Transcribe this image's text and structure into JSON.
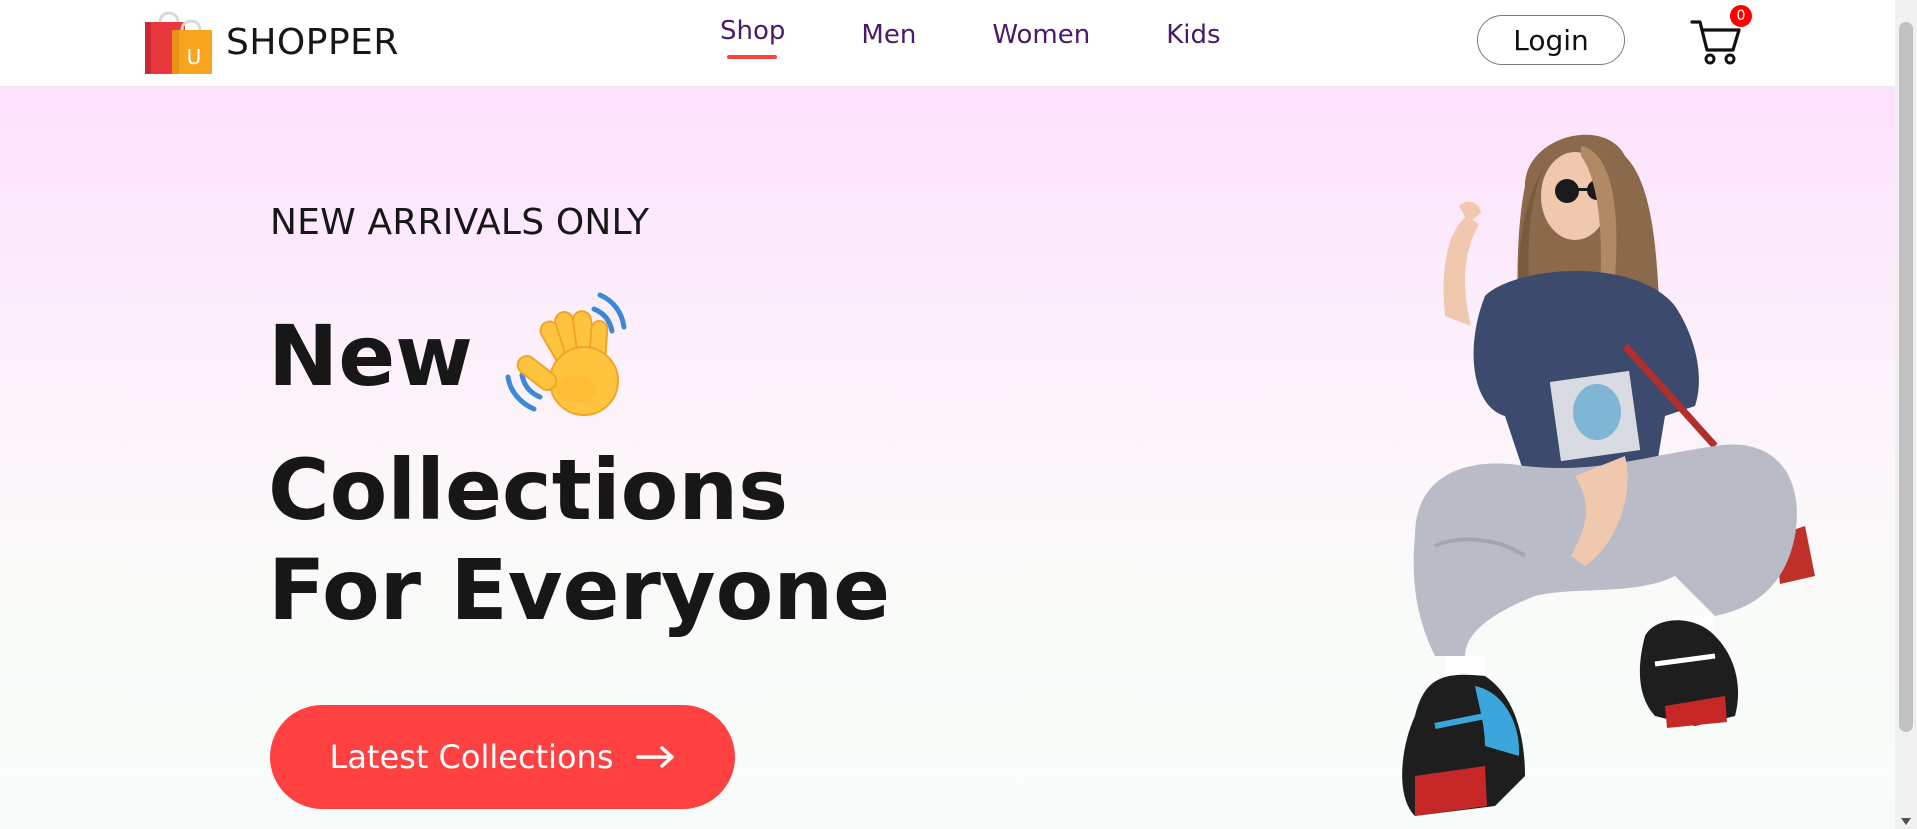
{
  "brand": {
    "name": "SHOPPER",
    "logo_letter": "U",
    "logo_icon": "shopping-bag-icon"
  },
  "nav": {
    "items": [
      {
        "label": "Shop",
        "active": true
      },
      {
        "label": "Men",
        "active": false
      },
      {
        "label": "Women",
        "active": false
      },
      {
        "label": "Kids",
        "active": false
      }
    ]
  },
  "header": {
    "login_label": "Login",
    "cart_icon": "cart-icon",
    "cart_count": "0"
  },
  "hero": {
    "subtitle": "NEW ARRIVALS ONLY",
    "headline_line1": "New",
    "headline_emoji": "waving-hand-icon",
    "headline_line2": "Collections",
    "headline_line3": "For Everyone",
    "cta_label": "Latest Collections",
    "cta_icon": "arrow-right-icon",
    "image": "model-photo"
  },
  "colors": {
    "accent": "#ff4141",
    "nav_text": "#4a1a6b",
    "hero_gradient_top": "#fce1fd",
    "hero_gradient_bottom": "#f7fcfa",
    "badge": "#ff0000"
  }
}
